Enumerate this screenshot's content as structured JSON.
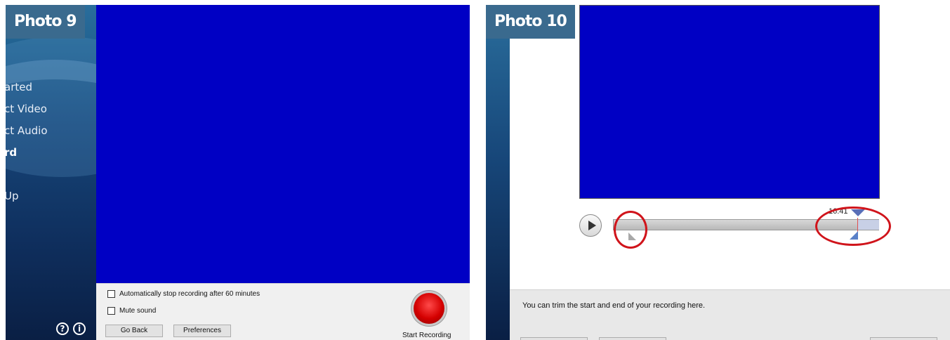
{
  "panel9": {
    "tag": "Photo 9",
    "nav": [
      {
        "label": "arted",
        "active": false
      },
      {
        "label": "ct Video",
        "active": false
      },
      {
        "label": "ct Audio",
        "active": false
      },
      {
        "label": "rd",
        "active": true
      },
      {
        "label": "Up",
        "active": false
      }
    ],
    "help_icon": "?",
    "info_icon": "i",
    "auto_stop_label": "Automatically stop recording after 60 minutes",
    "mute_label": "Mute sound",
    "go_back_label": "Go Back",
    "preferences_label": "Preferences",
    "start_recording_label": "Start Recording",
    "colors": {
      "video": "#0000c4",
      "record": "#d40000"
    }
  },
  "panel10": {
    "tag": "Photo 10",
    "time": "16:41",
    "message": "You can trim the start and end of your recording here.",
    "colors": {
      "video": "#0000c4",
      "highlight": "#d0141b"
    }
  }
}
